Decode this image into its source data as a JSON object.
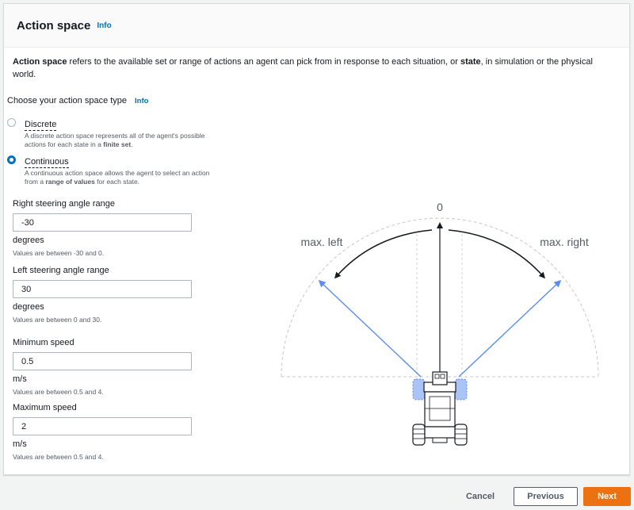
{
  "header": {
    "title": "Action space",
    "info": "Info"
  },
  "description": {
    "part1": "Action space",
    "part2": " refers to the available set or range of actions an agent can pick from in response to each situation, or ",
    "part3": "state",
    "part4": ", in simulation or the physical world."
  },
  "type_selector": {
    "label": "Choose your action space type",
    "info": "Info",
    "selected": "Continuous",
    "options": [
      {
        "label": "Discrete",
        "desc1": "A discrete action space represents all of the agent's possible actions for each state in a ",
        "desc_bold": "finite set",
        "desc2": "."
      },
      {
        "label": "Continuous",
        "desc1": "A continuous action space allows the agent to select an action from a ",
        "desc_bold": "range of values",
        "desc2": " for each state."
      }
    ]
  },
  "fields": [
    {
      "label": "Right steering angle range",
      "value": "-30",
      "unit": "degrees",
      "hint": "Values are between -30 and 0."
    },
    {
      "label": "Left steering angle range",
      "value": "30",
      "unit": "degrees",
      "hint": "Values are between 0 and 30."
    },
    {
      "label": "Minimum speed",
      "value": "0.5",
      "unit": "m/s",
      "hint": "Values are between 0.5 and 4."
    },
    {
      "label": "Maximum speed",
      "value": "2",
      "unit": "m/s",
      "hint": "Values are between 0.5 and 4."
    }
  ],
  "diagram": {
    "zero_label": "0",
    "left_label": "max. left",
    "right_label": "max. right"
  },
  "footer": {
    "cancel": "Cancel",
    "previous": "Previous",
    "next": "Next"
  },
  "colors": {
    "accent": "#0073bb",
    "primary_button": "#ec7211",
    "arrow_blue": "#5b8def"
  }
}
